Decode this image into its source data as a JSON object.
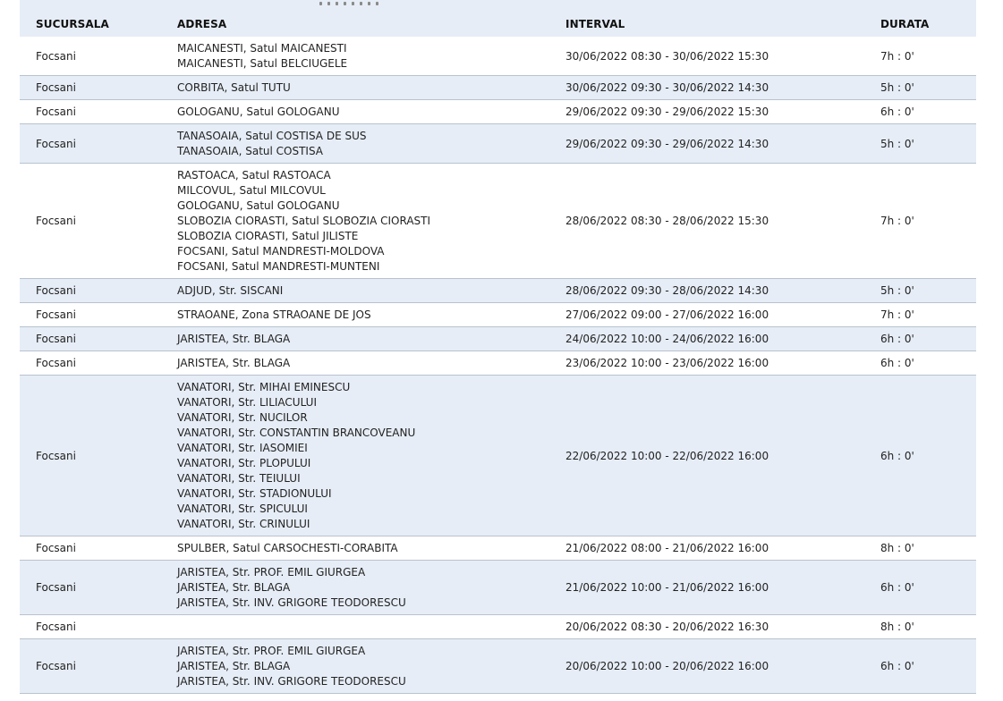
{
  "columns": {
    "branch": "SUCURSALA",
    "address": "ADRESA",
    "interval": "INTERVAL",
    "duration": "DURATA"
  },
  "rows": [
    {
      "branch": "Focsani",
      "address": [
        "MAICANESTI, Satul MAICANESTI",
        "MAICANESTI, Satul BELCIUGELE"
      ],
      "interval": "30/06/2022 08:30 - 30/06/2022 15:30",
      "duration": "7h : 0'"
    },
    {
      "branch": "Focsani",
      "address": [
        "CORBITA, Satul TUTU"
      ],
      "interval": "30/06/2022 09:30 - 30/06/2022 14:30",
      "duration": "5h : 0'"
    },
    {
      "branch": "Focsani",
      "address": [
        "GOLOGANU, Satul GOLOGANU"
      ],
      "interval": "29/06/2022 09:30 - 29/06/2022 15:30",
      "duration": "6h : 0'"
    },
    {
      "branch": "Focsani",
      "address": [
        "TANASOAIA, Satul COSTISA DE SUS",
        "TANASOAIA, Satul COSTISA"
      ],
      "interval": "29/06/2022 09:30 - 29/06/2022 14:30",
      "duration": "5h : 0'"
    },
    {
      "branch": "Focsani",
      "address": [
        "RASTOACA, Satul RASTOACA",
        "MILCOVUL, Satul MILCOVUL",
        "GOLOGANU, Satul GOLOGANU",
        "SLOBOZIA CIORASTI, Satul SLOBOZIA CIORASTI",
        "SLOBOZIA CIORASTI, Satul JILISTE",
        "FOCSANI, Satul MANDRESTI-MOLDOVA",
        "FOCSANI, Satul MANDRESTI-MUNTENI"
      ],
      "interval": "28/06/2022 08:30 - 28/06/2022 15:30",
      "duration": "7h : 0'"
    },
    {
      "branch": "Focsani",
      "address": [
        "ADJUD, Str. SISCANI"
      ],
      "interval": "28/06/2022 09:30 - 28/06/2022 14:30",
      "duration": "5h : 0'"
    },
    {
      "branch": "Focsani",
      "address": [
        "STRAOANE, Zona STRAOANE DE JOS"
      ],
      "interval": "27/06/2022 09:00 - 27/06/2022 16:00",
      "duration": "7h : 0'"
    },
    {
      "branch": "Focsani",
      "address": [
        "JARISTEA, Str. BLAGA"
      ],
      "interval": "24/06/2022 10:00 - 24/06/2022 16:00",
      "duration": "6h : 0'"
    },
    {
      "branch": "Focsani",
      "address": [
        "JARISTEA, Str. BLAGA"
      ],
      "interval": "23/06/2022 10:00 - 23/06/2022 16:00",
      "duration": "6h : 0'"
    },
    {
      "branch": "Focsani",
      "address": [
        "VANATORI, Str. MIHAI EMINESCU",
        "VANATORI, Str. LILIACULUI",
        "VANATORI, Str. NUCILOR",
        "VANATORI, Str. CONSTANTIN BRANCOVEANU",
        "VANATORI, Str. IASOMIEI",
        "VANATORI, Str. PLOPULUI",
        "VANATORI, Str. TEIULUI",
        "VANATORI, Str. STADIONULUI",
        "VANATORI, Str. SPICULUI",
        "VANATORI, Str. CRINULUI"
      ],
      "interval": "22/06/2022 10:00 - 22/06/2022 16:00",
      "duration": "6h : 0'"
    },
    {
      "branch": "Focsani",
      "address": [
        "SPULBER, Satul CARSOCHESTI-CORABITA"
      ],
      "interval": "21/06/2022 08:00 - 21/06/2022 16:00",
      "duration": "8h : 0'"
    },
    {
      "branch": "Focsani",
      "address": [
        "JARISTEA, Str. PROF. EMIL GIURGEA",
        "JARISTEA, Str. BLAGA",
        "JARISTEA, Str. INV. GRIGORE TEODORESCU"
      ],
      "interval": "21/06/2022 10:00 - 21/06/2022 16:00",
      "duration": "6h : 0'"
    },
    {
      "branch": "Focsani",
      "address": [],
      "interval": "20/06/2022 08:30 - 20/06/2022 16:30",
      "duration": "8h : 0'"
    },
    {
      "branch": "Focsani",
      "address": [
        "JARISTEA, Str. PROF. EMIL GIURGEA",
        "JARISTEA, Str. BLAGA",
        "JARISTEA, Str. INV. GRIGORE TEODORESCU"
      ],
      "interval": "20/06/2022 10:00 - 20/06/2022 16:00",
      "duration": "6h : 0'"
    }
  ]
}
